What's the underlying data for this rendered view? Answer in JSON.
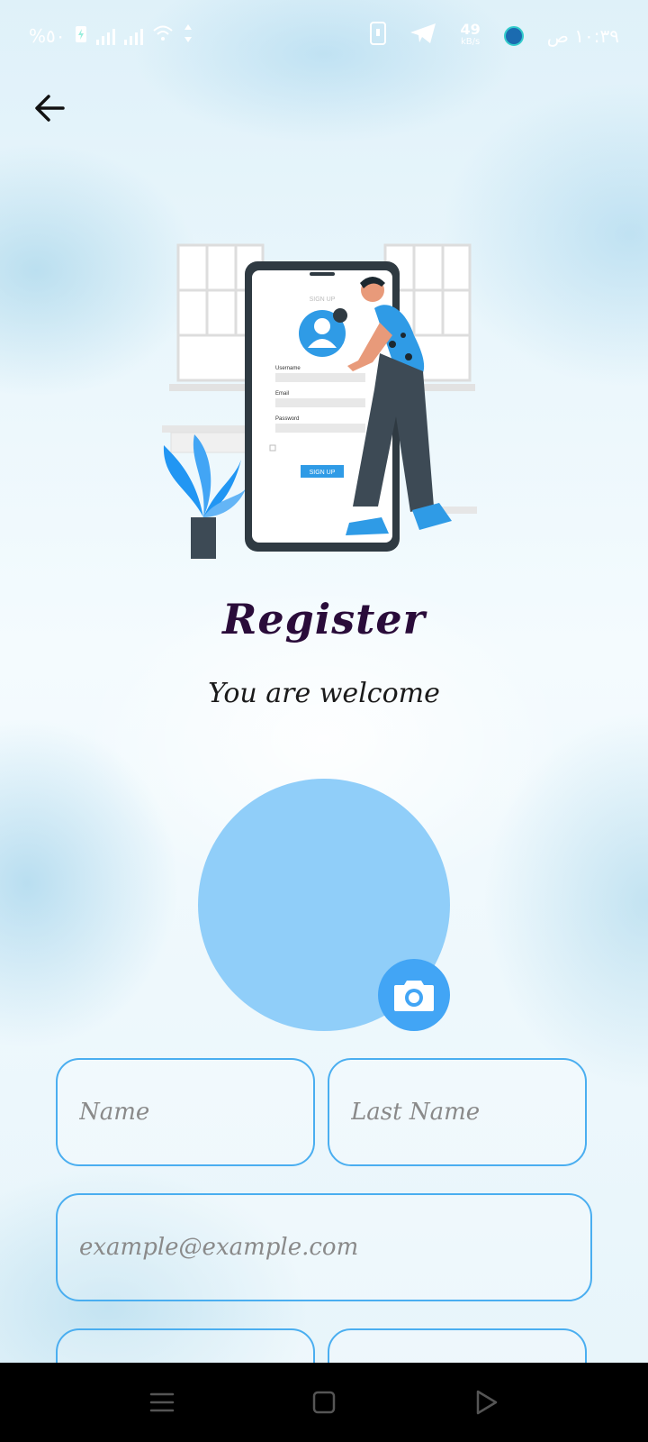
{
  "status_bar": {
    "battery": "%٥٠",
    "speed_value": "49",
    "speed_unit": "kB/s",
    "time": "١٠:٣٩ ص"
  },
  "header": {
    "back_icon": "arrow-left-icon"
  },
  "illustration": {
    "screen_title": "SIGN UP",
    "username_label": "Username",
    "email_label": "Email",
    "password_label": "Password",
    "signup_button": "SIGN UP"
  },
  "main": {
    "title": "Register",
    "subtitle": "You are welcome",
    "avatar_color": "#90cef9",
    "camera_icon": "camera-icon",
    "accent": "#42a5f5"
  },
  "form": {
    "name_placeholder": "Name",
    "last_name_placeholder": "Last Name",
    "email_placeholder": "example@example.com"
  },
  "nav": {
    "menu_icon": "menu-icon",
    "home_icon": "home-square-icon",
    "back_icon": "back-triangle-icon"
  }
}
